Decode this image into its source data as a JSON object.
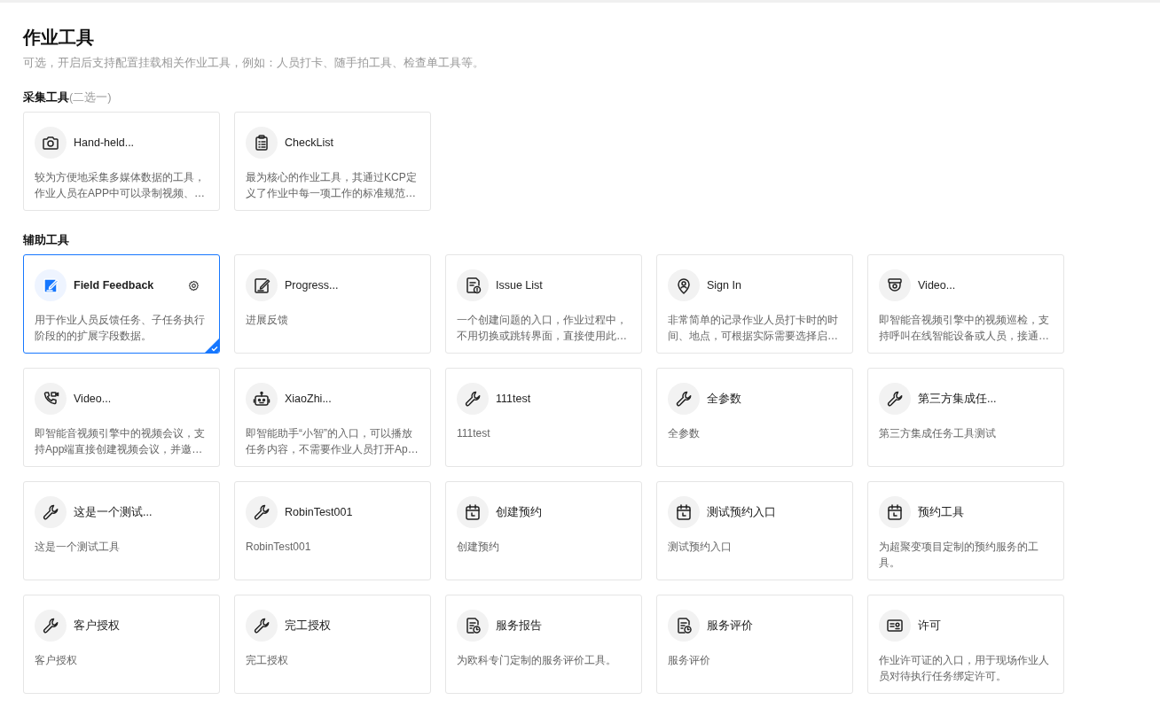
{
  "page": {
    "title": "作业工具",
    "subtitle": "可选，开启后支持配置挂载相关作业工具，例如：人员打卡、随手拍工具、检查单工具等。"
  },
  "sections": [
    {
      "heading": "**采集工具**(二选一)",
      "tools": [
        {
          "kind": "camera",
          "name": "Hand-held...",
          "description": "较为方便地采集多媒体数据的工具，作业人员在APP中可以录制视频、…",
          "selected": false
        },
        {
          "kind": "clipboard",
          "name": "CheckList",
          "description": "最为核心的作业工具，其通过KCP定义了作业中每一项工作的标准规范…",
          "selected": false
        }
      ]
    },
    {
      "heading": "**辅助工具**",
      "tools": [
        {
          "kind": "edit",
          "name": "Field Feedback",
          "description": "用于作业人员反馈任务、子任务执行阶段的的扩展字段数据。",
          "selected": true
        },
        {
          "kind": "edit",
          "name": "Progress...",
          "description": "进展反馈",
          "selected": false
        },
        {
          "kind": "issue",
          "name": "Issue List",
          "description": "一个创建问题的入口，作业过程中，不用切换或跳转界面，直接使用此…",
          "selected": false
        },
        {
          "kind": "pin",
          "name": "Sign In",
          "description": "非常简单的记录作业人员打卡时的时间、地点，可根据实际需要选择启…",
          "selected": false
        },
        {
          "kind": "cctv",
          "name": "Video...",
          "description": "即智能音视频引擎中的视频巡检，支持呼叫在线智能设备或人员，接通…",
          "selected": false
        },
        {
          "kind": "videocall",
          "name": "Video...",
          "description": "即智能音视频引擎中的视频会议，支持App端直接创建视频会议，并邀…",
          "selected": false
        },
        {
          "kind": "robot",
          "name": "XiaoZhi...",
          "description": "即智能助手“小智”的入口，可以播放任务内容，不需要作业人员打开Ap…",
          "selected": false
        },
        {
          "kind": "wrench",
          "name": "111test",
          "description": "111test",
          "selected": false
        },
        {
          "kind": "wrench",
          "name": "全参数",
          "description": "全参数",
          "selected": false
        },
        {
          "kind": "wrench",
          "name": "第三方集成任...",
          "description": "第三方集成任务工具测试",
          "selected": false
        },
        {
          "kind": "wrench",
          "name": "这是一个测试...",
          "description": "这是一个测试工具",
          "selected": false
        },
        {
          "kind": "wrench",
          "name": "RobinTest001",
          "description": "RobinTest001",
          "selected": false
        },
        {
          "kind": "calendar",
          "name": "创建预约",
          "description": "创建预约",
          "selected": false
        },
        {
          "kind": "calendar",
          "name": "测试预约入口",
          "description": "测试预约入口",
          "selected": false
        },
        {
          "kind": "calendar",
          "name": "预约工具",
          "description": "为超聚变项目定制的预约服务的工具。",
          "selected": false
        },
        {
          "kind": "wrench",
          "name": "客户授权",
          "description": "客户授权",
          "selected": false
        },
        {
          "kind": "wrench",
          "name": "完工授权",
          "description": "完工授权",
          "selected": false
        },
        {
          "kind": "report",
          "name": "服务报告",
          "description": "为欧科专门定制的服务评价工具。",
          "selected": false
        },
        {
          "kind": "report",
          "name": "服务评价",
          "description": "服务评价",
          "selected": false
        },
        {
          "kind": "license",
          "name": "许可",
          "description": "作业许可证的入口，用于现场作业人员对待执行任务绑定许可。",
          "selected": false
        }
      ]
    }
  ]
}
